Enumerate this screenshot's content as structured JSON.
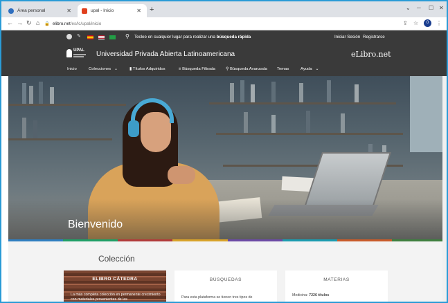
{
  "browser": {
    "tabs": [
      {
        "label": "Área personal"
      },
      {
        "label": "upal - Inicio"
      }
    ],
    "new_tab": "+",
    "window_controls": [
      "⌄",
      "─",
      "☐",
      "✕"
    ],
    "url_host": "elibro.net",
    "url_path": "/es/lc/upal/inicio",
    "profile_initial": "0"
  },
  "topbar": {
    "search_prefix": "Teclee en cualquier lugar para realizar una ",
    "search_bold": "búsqueda rápida",
    "login": "Iniciar Sesión",
    "register": "Registrarse"
  },
  "brand": {
    "logo_text": "UPAL",
    "university": "Universidad Privada Abierta Latinoamericana",
    "elibro": "eLibro.net"
  },
  "menu": {
    "inicio": "Inicio",
    "colecciones": "Colecciones",
    "titulos": "Títulos Adquiridos",
    "filtrada": "Búsqueda Filtrada",
    "avanzada": "Búsqueda Avanzada",
    "temas": "Temas",
    "ayuda": "Ayuda"
  },
  "hero": {
    "title": "Bienvenido"
  },
  "collection": {
    "title": "Colección",
    "cards": [
      {
        "title": "ELIBRO CÁTEDRA",
        "text": "La más completa colección en permanente crecimiento con materiales provenientes de las"
      },
      {
        "title": "BÚSQUEDAS",
        "text": "Para esta plataforma se tienen tres tipos de"
      },
      {
        "title": "MATERIAS",
        "text_prefix": "Medicina: ",
        "text_bold": "7226 títulos"
      }
    ]
  },
  "colors": {
    "accent_border": "#2a9bd6",
    "header_bg": "#3a3a3a",
    "strip": [
      "#2f7ec1",
      "#1f9f66",
      "#b23b3b",
      "#d8a329",
      "#6b4aa5",
      "#1b9cb0",
      "#c95b2a",
      "#3f7f3f"
    ]
  }
}
